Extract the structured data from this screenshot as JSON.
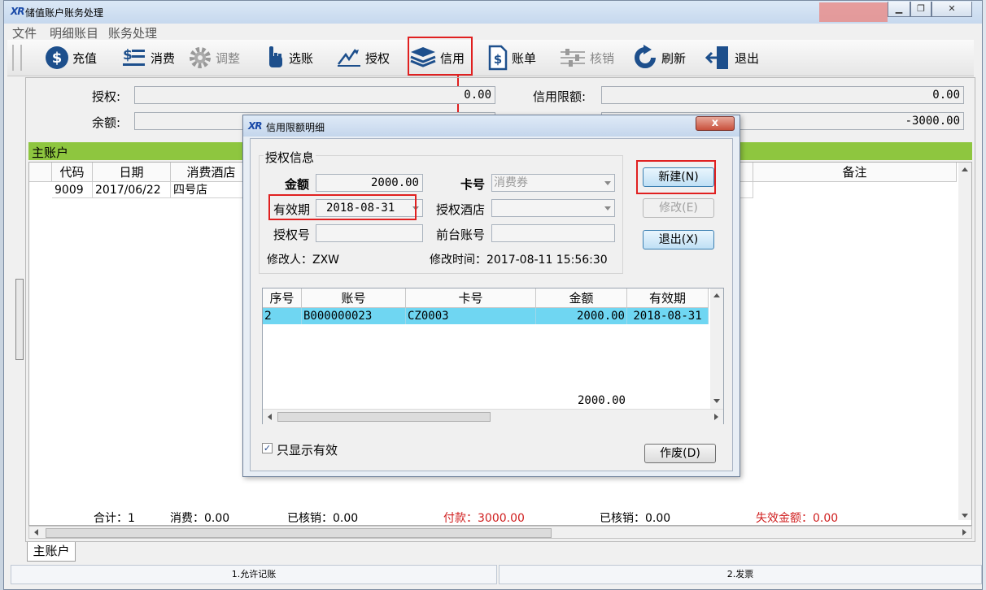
{
  "window": {
    "title": "储值账户账务处理",
    "logo": "XR"
  },
  "menu": [
    "文件",
    "明细账目",
    "账务处理"
  ],
  "toolbar": {
    "items": [
      {
        "label": "充值",
        "icon": "dollar-coin-icon",
        "enabled": true
      },
      {
        "label": "消费",
        "icon": "dollar-list-icon",
        "enabled": true
      },
      {
        "label": "调整",
        "icon": "gear-icon",
        "enabled": false
      },
      {
        "label": "选账",
        "icon": "hand-pointer-icon",
        "enabled": true
      },
      {
        "label": "授权",
        "icon": "pencil-sign-icon",
        "enabled": true
      },
      {
        "label": "信用",
        "icon": "stacked-cards-icon",
        "enabled": true
      },
      {
        "label": "账单",
        "icon": "dollar-document-icon",
        "enabled": true
      },
      {
        "label": "核销",
        "icon": "sliders-icon",
        "enabled": false
      },
      {
        "label": "刷新",
        "icon": "refresh-icon",
        "enabled": true
      },
      {
        "label": "退出",
        "icon": "exit-door-icon",
        "enabled": true
      }
    ]
  },
  "info": {
    "auth_label": "授权:",
    "auth_value": "0.00",
    "credit_limit_label": "信用限额:",
    "credit_limit_value": "0.00",
    "balance_label": "余额:",
    "balance_value": "-3000.00"
  },
  "main_account_label": "主账户",
  "grid": {
    "columns": [
      "代码",
      "日期",
      "消费酒店",
      "备注"
    ],
    "rows": [
      {
        "code": "9009",
        "date": "2017/06/22",
        "hotel": "四号店"
      }
    ]
  },
  "summary": {
    "total": "合计：1",
    "consume": "消费：0.00",
    "written_off1": "已核销：0.00",
    "paid": "付款：3000.00",
    "written_off2": "已核销：0.00",
    "invalid": "失效金额：0.00"
  },
  "tab_label": "主账户",
  "status": {
    "left": "1.允许记账",
    "right": "2.发票"
  },
  "dialog": {
    "title": "信用限额明细",
    "group_title": "授权信息",
    "amount_label": "金额",
    "amount_value": "2000.00",
    "card_label": "卡号",
    "card_value": "消费券",
    "expiry_label": "有效期",
    "expiry_value": "2018-08-31",
    "auth_hotel_label": "授权酒店",
    "auth_hotel_value": "",
    "auth_no_label": "授权号",
    "front_account_label": "前台账号",
    "modifier": "修改人：ZXW",
    "modify_time": "修改时间：2017-08-11 15:56:30",
    "new_button": "新建(N)",
    "edit_button": "修改(E)",
    "exit_button": "退出(X)",
    "void_button": "作废(D)",
    "checkbox_label": "只显示有效",
    "checkbox_checked": true,
    "table": {
      "columns": [
        "序号",
        "账号",
        "卡号",
        "金额",
        "有效期"
      ],
      "rows": [
        {
          "seq": "2",
          "account": "B000000023",
          "card": "CZ0003",
          "amount": "2000.00",
          "expiry": "2018-08-31"
        }
      ],
      "total": "2000.00"
    },
    "close_label": "x"
  },
  "colors": {
    "highlight_row": "#6fd6f2",
    "green_bar": "#8ec63f",
    "annotation_red": "#e02020",
    "summary_red": "#d02020"
  }
}
